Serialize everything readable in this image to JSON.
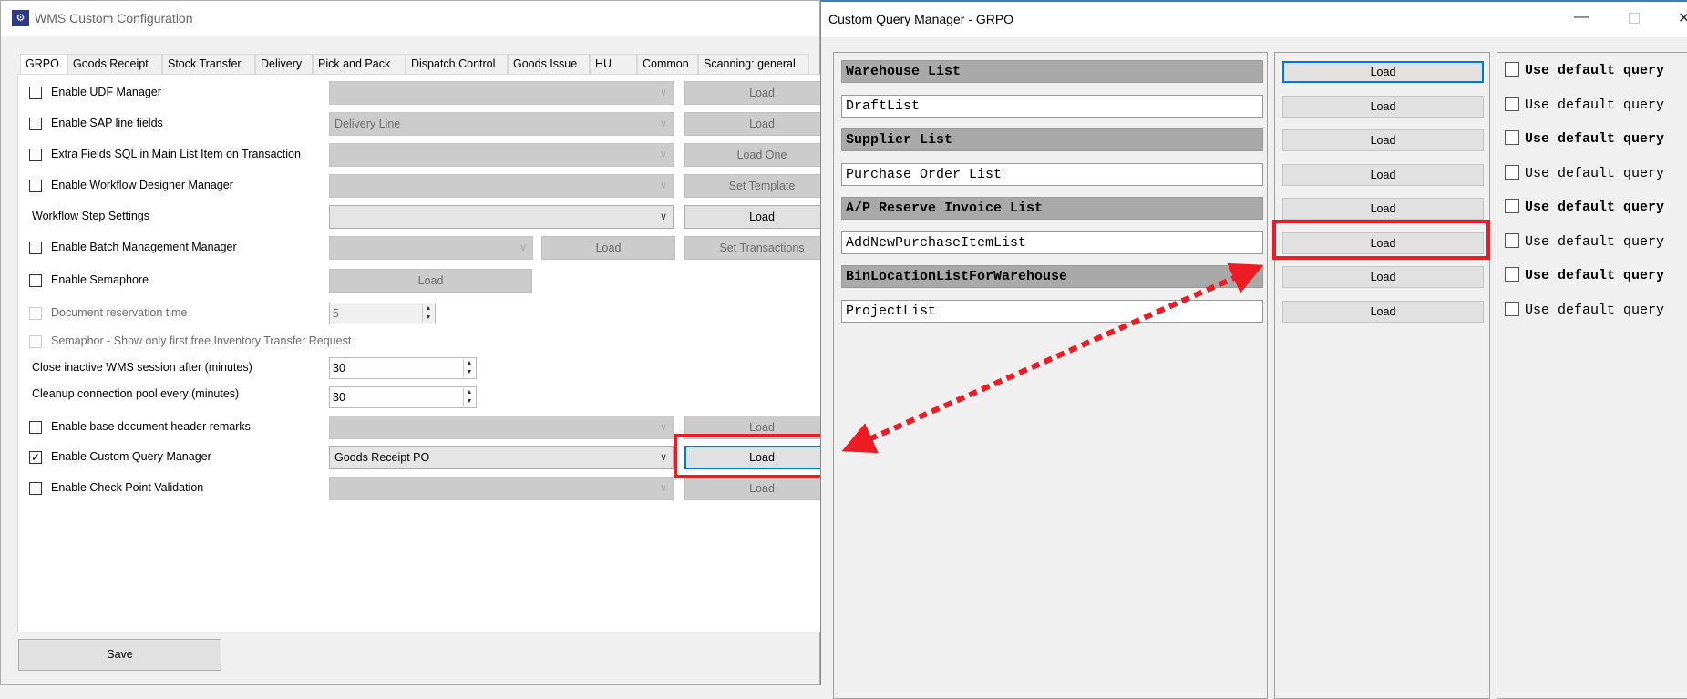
{
  "main_window": {
    "title": "WMS Custom Configuration",
    "tabs": [
      "GRPO",
      "Goods Receipt",
      "Stock Transfer",
      "Delivery",
      "Pick and Pack",
      "Dispatch Control",
      "Goods Issue",
      "HU",
      "Common",
      "Scanning: general"
    ],
    "rows": {
      "udf": {
        "label": "Enable UDF Manager",
        "checked": false,
        "combo": "",
        "button": "Load"
      },
      "sap_line": {
        "label": "Enable SAP line fields",
        "checked": false,
        "combo": "Delivery Line",
        "button": "Load"
      },
      "extra_fields": {
        "label": "Extra Fields SQL in Main List Item on Transaction",
        "checked": false,
        "combo": "",
        "button": "Load One"
      },
      "workflow_designer": {
        "label": "Enable Workflow Designer Manager",
        "checked": false,
        "combo": "",
        "button": "Set Template"
      },
      "workflow_step": {
        "label": "Workflow Step Settings",
        "combo": "",
        "button": "Load"
      },
      "batch": {
        "label": "Enable Batch Management Manager",
        "checked": false,
        "combo": "",
        "button": "Load",
        "button2": "Set Transactions"
      },
      "semaphore": {
        "label": "Enable Semaphore",
        "checked": false,
        "button": "Load"
      },
      "doc_reservation": {
        "label": "Document reservation time",
        "checked": false,
        "value": "5"
      },
      "semaphor_first": {
        "label": "Semaphor - Show only first free Inventory Transfer Request",
        "checked": false
      },
      "close_inactive": {
        "label": "Close inactive WMS session after (minutes)",
        "value": "30"
      },
      "cleanup": {
        "label": "Cleanup connection pool every (minutes)",
        "value": "30"
      },
      "base_doc": {
        "label": "Enable base document header remarks",
        "checked": false,
        "combo": "",
        "button": "Load"
      },
      "custom_query": {
        "label": "Enable Custom Query Manager",
        "checked": true,
        "combo": "Goods Receipt PO",
        "button": "Load"
      },
      "check_point": {
        "label": "Enable Check Point Validation",
        "checked": false,
        "combo": "",
        "button": "Load"
      }
    },
    "save_label": "Save",
    "checkmark": "✓"
  },
  "query_window": {
    "title": "Custom Query Manager - GRPO",
    "queries": [
      {
        "name": "Warehouse List",
        "header": true,
        "button": "Load",
        "default_label": "Use default query"
      },
      {
        "name": "DraftList",
        "header": false,
        "button": "Load",
        "default_label": "Use default query"
      },
      {
        "name": "Supplier List",
        "header": true,
        "button": "Load",
        "default_label": "Use default query"
      },
      {
        "name": "Purchase Order List",
        "header": false,
        "button": "Load",
        "default_label": "Use default query"
      },
      {
        "name": "A/P Reserve Invoice List",
        "header": true,
        "button": "Load",
        "default_label": "Use default query"
      },
      {
        "name": "AddNewPurchaseItemList",
        "header": false,
        "button": "Load",
        "default_label": "Use default query"
      },
      {
        "name": "BinLocationListForWarehouse",
        "header": true,
        "button": "Load",
        "default_label": "Use default query"
      },
      {
        "name": "ProjectList",
        "header": false,
        "button": "Load",
        "default_label": "Use default query"
      }
    ]
  },
  "annotation_color": "#ed1c24"
}
